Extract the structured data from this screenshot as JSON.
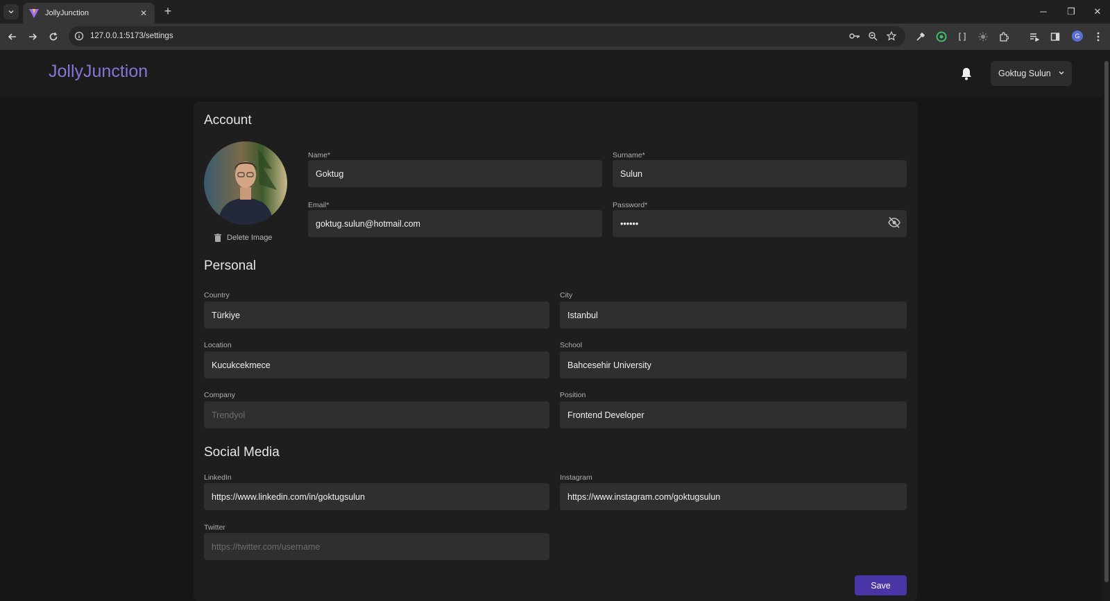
{
  "browser": {
    "tab_title": "JollyJunction",
    "url": "127.0.0.1:5173/settings",
    "profile_initial": "G"
  },
  "header": {
    "logo": "JollyJunction",
    "user_name": "Goktug Sulun"
  },
  "account": {
    "title": "Account",
    "delete_image": "Delete Image",
    "name_label": "Name*",
    "name_value": "Goktug",
    "surname_label": "Surname*",
    "surname_value": "Sulun",
    "email_label": "Email*",
    "email_value": "goktug.sulun@hotmail.com",
    "password_label": "Password*",
    "password_value": "sulun1"
  },
  "personal": {
    "title": "Personal",
    "country_label": "Country",
    "country_value": "Türkiye",
    "city_label": "City",
    "city_value": "Istanbul",
    "location_label": "Location",
    "location_value": "Kucukcekmece",
    "school_label": "School",
    "school_value": "Bahcesehir University",
    "company_label": "Company",
    "company_placeholder": "Trendyol",
    "position_label": "Position",
    "position_value": "Frontend Developer"
  },
  "social": {
    "title": "Social Media",
    "linkedin_label": "LinkedIn",
    "linkedin_value": "https://www.linkedin.com/in/goktugsulun",
    "instagram_label": "Instagram",
    "instagram_value": "https://www.instagram.com/goktugsulun",
    "twitter_label": "Twitter",
    "twitter_placeholder": "https://twitter.com/username"
  },
  "actions": {
    "save_label": "Save"
  },
  "colors": {
    "accent": "#4a35a6",
    "logo": "#8b74d8"
  }
}
